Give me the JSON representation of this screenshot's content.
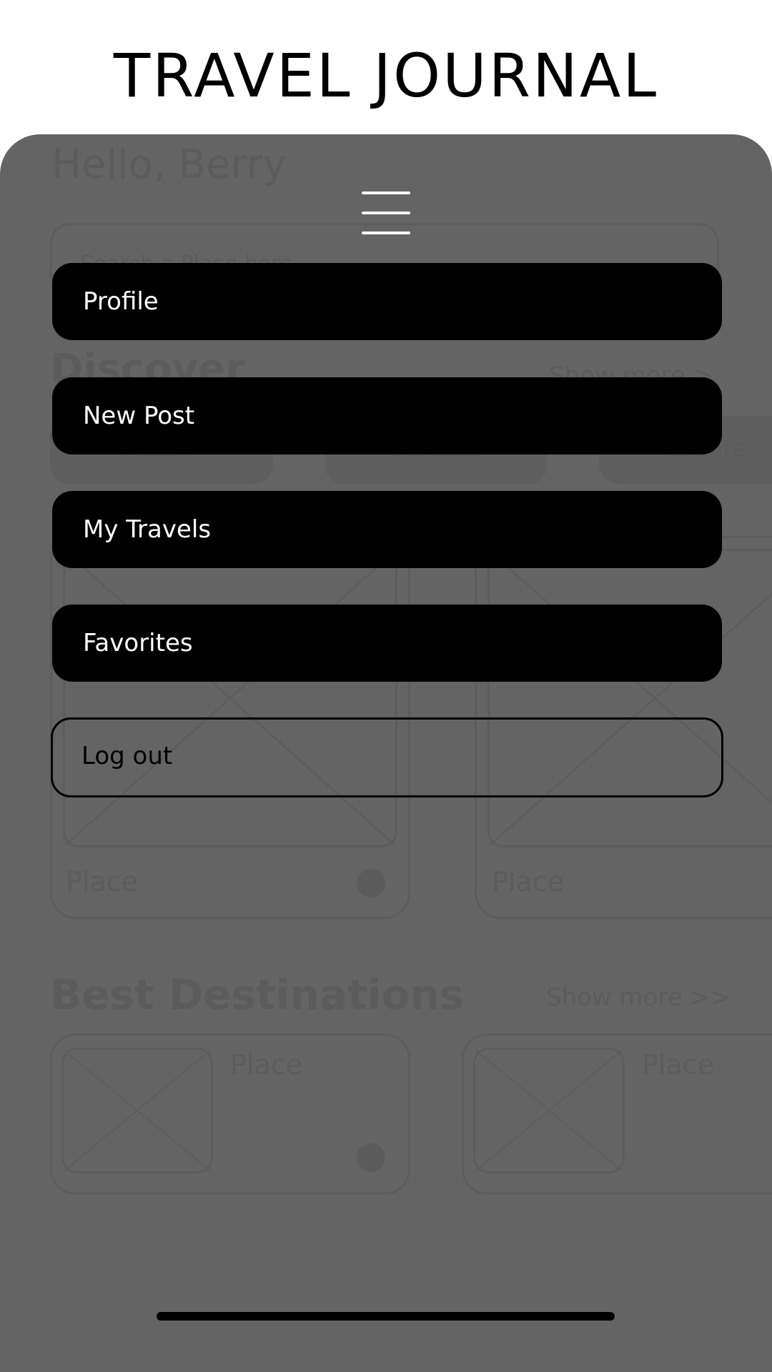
{
  "header": {
    "title": "TRAVEL JOURNAL"
  },
  "background": {
    "greeting": "Hello, Berry",
    "search_placeholder": "Search a Place here",
    "discover_heading": "Discover",
    "show_more": "Show more >",
    "chips": [
      "Place",
      "Culture",
      "Nature"
    ],
    "card_label": "Place",
    "best_heading": "Best Destinations",
    "best_show_more": "Show more >>"
  },
  "menu": {
    "toggle_icon": "hamburger-icon",
    "items": [
      {
        "label": "Profile"
      },
      {
        "label": "New Post"
      },
      {
        "label": "My Travels"
      },
      {
        "label": "Favorites"
      }
    ],
    "logout_label": "Log out"
  },
  "colors": {
    "overlay": "#646464",
    "button_fill": "#000000",
    "button_text": "#ffffff"
  }
}
